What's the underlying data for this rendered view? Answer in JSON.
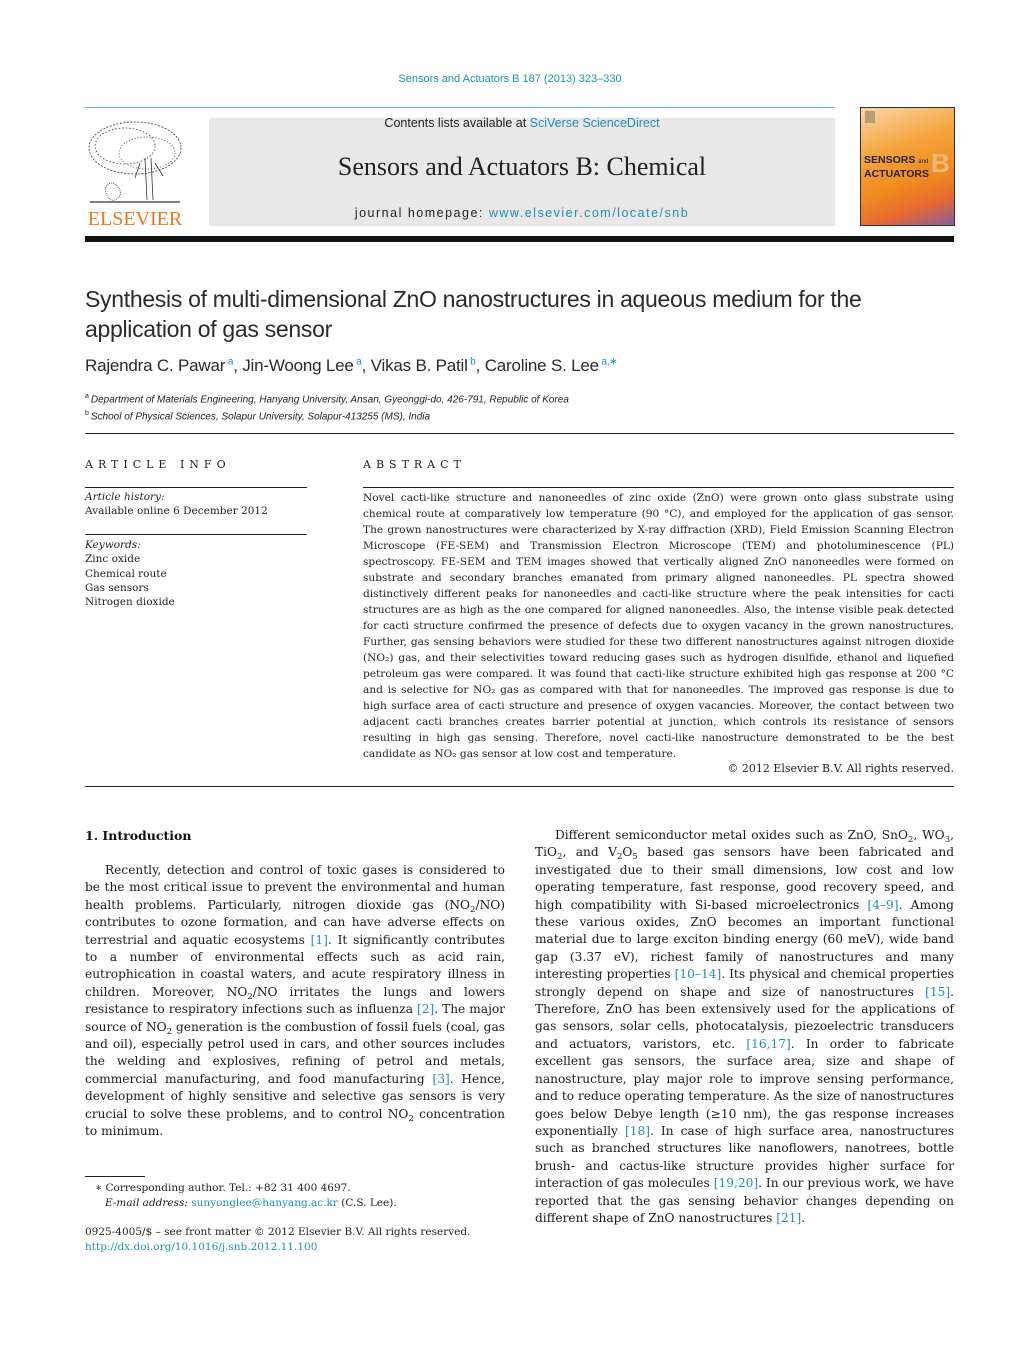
{
  "header": {
    "citation": "Sensors and Actuators B 187 (2013) 323–330",
    "contents_prefix": "Contents lists available at ",
    "contents_link": "SciVerse ScienceDirect",
    "journal_title": "Sensors and Actuators B: Chemical",
    "homepage_prefix": "journal homepage: ",
    "homepage_link": "www.elsevier.com/locate/snb",
    "publisher_wordmark": "ELSEVIER",
    "cover_line1": "SENSORS",
    "cover_and": "and",
    "cover_line2": "ACTUATORS",
    "cover_letter": "B"
  },
  "article": {
    "title": "Synthesis of multi-dimensional ZnO nanostructures in aqueous medium for the application of gas sensor",
    "authors": [
      {
        "name": "Rajendra C. Pawar",
        "sup": "a"
      },
      {
        "name": "Jin-Woong Lee",
        "sup": "a"
      },
      {
        "name": "Vikas B. Patil",
        "sup": "b"
      },
      {
        "name": "Caroline S. Lee",
        "sup": "a,∗"
      }
    ],
    "affiliations": [
      {
        "sup": "a",
        "text": "Department of Materials Engineering, Hanyang University, Ansan, Gyeonggi-do, 426-791, Republic of Korea"
      },
      {
        "sup": "b",
        "text": "School of Physical Sciences, Solapur University, Solapur-413255 (MS), India"
      }
    ]
  },
  "article_info": {
    "heading": "ARTICLE INFO",
    "history_label": "Article history:",
    "history_value": "Available online 6 December 2012",
    "keywords_label": "Keywords:",
    "keywords": [
      "Zinc oxide",
      "Chemical route",
      "Gas sensors",
      "Nitrogen dioxide"
    ]
  },
  "abstract": {
    "heading": "ABSTRACT",
    "text": "Novel cacti-like structure and nanoneedles of zinc oxide (ZnO) were grown onto glass substrate using chemical route at comparatively low temperature (90 °C), and employed for the application of gas sensor. The grown nanostructures were characterized by X-ray diffraction (XRD), Field Emission Scanning Electron Microscope (FE-SEM) and Transmission Electron Microscope (TEM) and photoluminescence (PL) spectroscopy. FE-SEM and TEM images showed that vertically aligned ZnO nanoneedles were formed on substrate and secondary branches emanated from primary aligned nanoneedles. PL spectra showed distinctively different peaks for nanoneedles and cacti-like structure where the peak intensities for cacti structures are as high as the one compared for aligned nanoneedles. Also, the intense visible peak detected for cacti structure confirmed the presence of defects due to oxygen vacancy in the grown nanostructures. Further, gas sensing behaviors were studied for these two different nanostructures against nitrogen dioxide (NO₂) gas, and their selectivities toward reducing gases such as hydrogen disulfide, ethanol and liquefied petroleum gas were compared. It was found that cacti-like structure exhibited high gas response at 200 °C and is selective for NO₂ gas as compared with that for nanoneedles. The improved gas response is due to high surface area of cacti structure and presence of oxygen vacancies. Moreover, the contact between two adjacent cacti branches creates barrier potential at junction, which controls its resistance of sensors resulting in high gas sensing. Therefore, novel cacti-like nanostructure demonstrated to be the best candidate as NO₂ gas sensor at low cost and temperature.",
    "copyright": "© 2012 Elsevier B.V. All rights reserved."
  },
  "introduction": {
    "heading": "1.  Introduction",
    "left": [
      {
        "t": "Recently, detection and control of toxic gases is considered to be the most critical issue to prevent the environmental and human health problems. Particularly, nitrogen dioxide gas (NO"
      },
      {
        "sub": "2"
      },
      {
        "t": "/NO) contributes to ozone formation, and can have adverse effects on terrestrial and aquatic ecosystems "
      },
      {
        "cite": "[1]"
      },
      {
        "t": ". It significantly contributes to a number of environmental effects such as acid rain, eutrophication in coastal waters, and acute respiratory illness in children. Moreover, NO"
      },
      {
        "sub": "2"
      },
      {
        "t": "/NO irritates the lungs and lowers resistance to respiratory infections such as influenza "
      },
      {
        "cite": "[2]"
      },
      {
        "t": ". The major source of NO"
      },
      {
        "sub": "2"
      },
      {
        "t": " generation is the combustion of fossil fuels (coal, gas and oil), especially petrol used in cars, and other sources includes the welding and explosives, refining of petrol and metals, commercial manufacturing, and food manufacturing "
      },
      {
        "cite": "[3]"
      },
      {
        "t": ". Hence, development of highly sensitive and selective gas sensors is very crucial to solve these problems, and to control NO"
      },
      {
        "sub": "2"
      },
      {
        "t": " concentration to minimum."
      }
    ],
    "right": [
      {
        "t": "Different semiconductor metal oxides such as ZnO, SnO"
      },
      {
        "sub": "2"
      },
      {
        "t": ", WO"
      },
      {
        "sub": "3"
      },
      {
        "t": ", TiO"
      },
      {
        "sub": "2"
      },
      {
        "t": ", and V"
      },
      {
        "sub": "2"
      },
      {
        "t": "O"
      },
      {
        "sub": "5"
      },
      {
        "t": " based gas sensors have been fabricated and investigated due to their small dimensions, low cost and low operating temperature, fast response, good recovery speed, and high compatibility with Si-based microelectronics "
      },
      {
        "cite": "[4–9]"
      },
      {
        "t": ". Among these various oxides, ZnO becomes an important functional material due to large exciton binding energy (60 meV), wide band gap (3.37 eV), richest family of nanostructures and many interesting properties "
      },
      {
        "cite": "[10–14]"
      },
      {
        "t": ". Its physical and chemical properties strongly depend on shape and size of nanostructures "
      },
      {
        "cite": "[15]"
      },
      {
        "t": ". Therefore, ZnO has been extensively used for the applications of gas sensors, solar cells, photocatalysis, piezoelectric transducers and actuators, varistors, etc. "
      },
      {
        "cite": "[16,17]"
      },
      {
        "t": ". In order to fabricate excellent gas sensors, the surface area, size and shape of nanostructure, play major role to improve sensing performance, and to reduce operating temperature. As the size of nanostructures goes below Debye length (≥10 nm), the gas response increases exponentially "
      },
      {
        "cite": "[18]"
      },
      {
        "t": ". In case of high surface area, nanostructures such as branched structures like nanoflowers, nanotrees, bottle brush- and cactus-like structure provides higher surface for interaction of gas molecules "
      },
      {
        "cite": "[19,20]"
      },
      {
        "t": ". In our previous work, we have reported that the gas sensing behavior changes depending on different shape of ZnO nanostructures "
      },
      {
        "cite": "[21]"
      },
      {
        "t": "."
      }
    ]
  },
  "footnotes": {
    "corresponding": "∗  Corresponding author. Tel.: +82 31 400 4697.",
    "email_label": "E-mail address: ",
    "email": "sunyonglee@hanyang.ac.kr",
    "email_suffix": " (C.S. Lee).",
    "front_matter": "0925-4005/$ – see front matter © 2012 Elsevier B.V. All rights reserved.",
    "doi": "http://dx.doi.org/10.1016/j.snb.2012.11.100"
  },
  "colors": {
    "link": "#1f8fb5",
    "elsevier_orange": "#e8781e",
    "header_box": "#e8e8e8"
  }
}
